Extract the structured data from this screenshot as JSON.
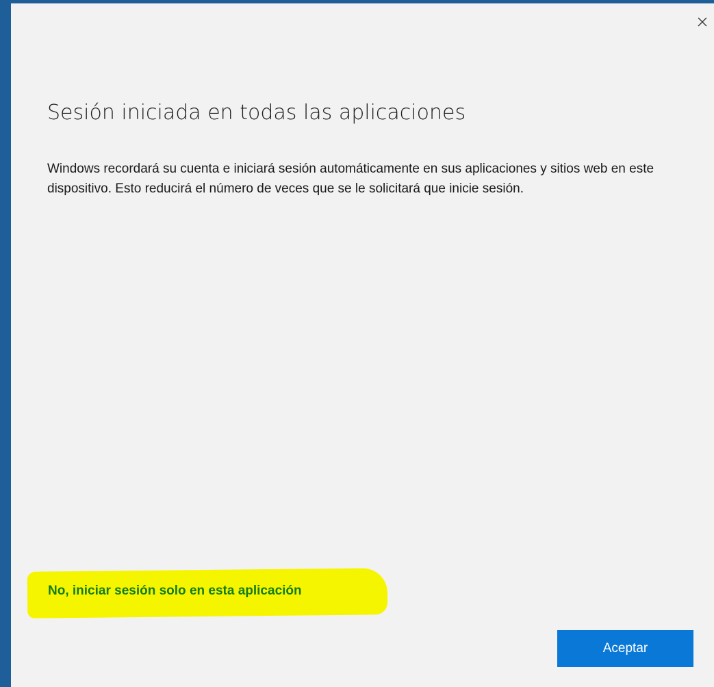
{
  "dialog": {
    "title": "Sesión iniciada en todas las aplicaciones",
    "description": "Windows recordará su cuenta e iniciará sesión automáticamente en sus aplicaciones y sitios web en este dispositivo. Esto reducirá el número de veces que se le solicitará que inicie sesión.",
    "alt_link_label": "No, iniciar sesión solo en esta aplicación",
    "accept_label": "Aceptar",
    "close_icon": "close-icon"
  },
  "colors": {
    "window_frame": "#1f5f99",
    "dialog_background": "#f2f2f2",
    "accent_button": "#0a78d7",
    "link_text": "#137d17",
    "highlight": "#f6f500"
  }
}
